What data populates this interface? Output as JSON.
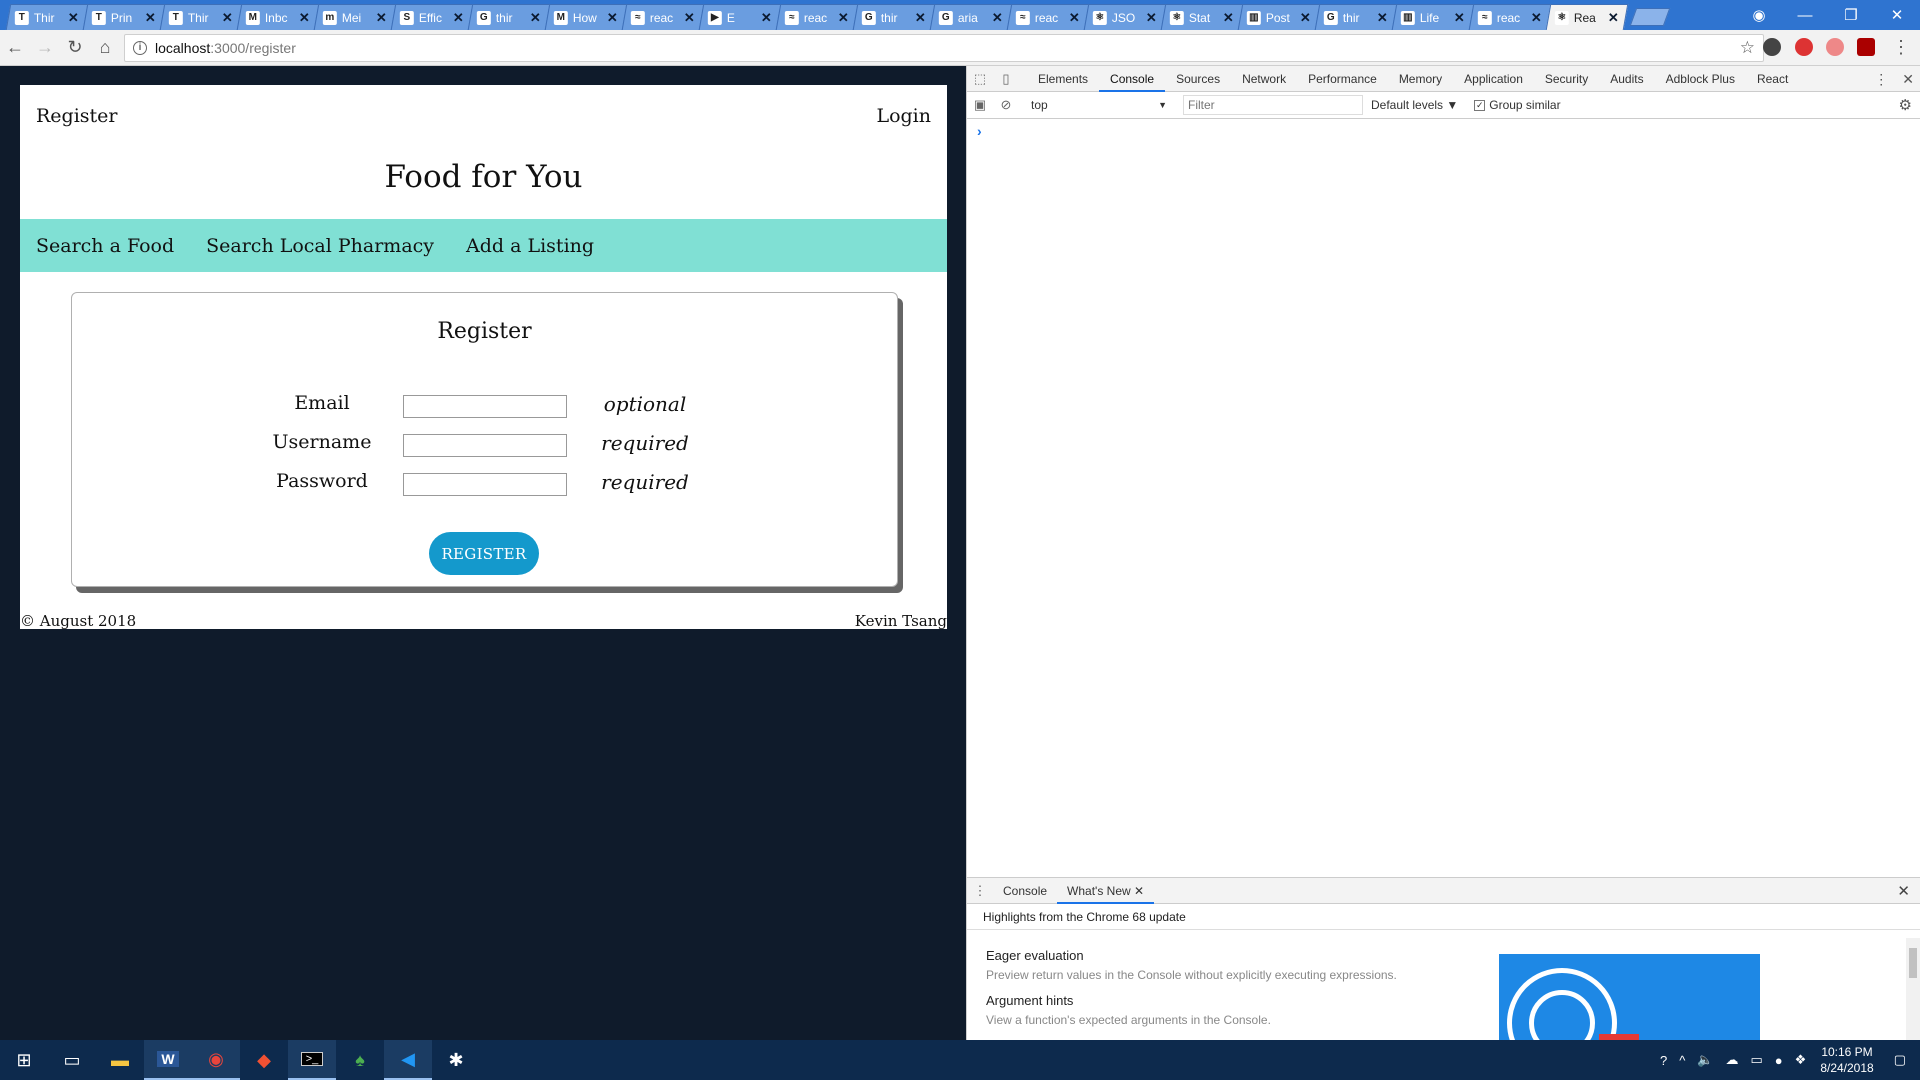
{
  "browser": {
    "tabs": [
      {
        "fav": "T",
        "title": "Thir"
      },
      {
        "fav": "T",
        "title": "Prin"
      },
      {
        "fav": "T",
        "title": "Thir"
      },
      {
        "fav": "M",
        "title": "Inbc"
      },
      {
        "fav": "m",
        "title": "Mei"
      },
      {
        "fav": "S",
        "title": "Effic"
      },
      {
        "fav": "G",
        "title": "thir"
      },
      {
        "fav": "M",
        "title": "How"
      },
      {
        "fav": "≈",
        "title": "reac"
      },
      {
        "fav": "▶",
        "title": "E"
      },
      {
        "fav": "≈",
        "title": "reac"
      },
      {
        "fav": "G",
        "title": "thir"
      },
      {
        "fav": "G",
        "title": "aria"
      },
      {
        "fav": "≈",
        "title": "reac"
      },
      {
        "fav": "⚛",
        "title": "JSO"
      },
      {
        "fav": "⚛",
        "title": "Stat"
      },
      {
        "fav": "▥",
        "title": "Post"
      },
      {
        "fav": "G",
        "title": "thir"
      },
      {
        "fav": "▥",
        "title": "Life"
      },
      {
        "fav": "≈",
        "title": "reac"
      },
      {
        "fav": "⚛",
        "title": "Rea"
      }
    ],
    "tab_close": "✕",
    "url_host": "localhost",
    "url_path": ":3000/register"
  },
  "page": {
    "nav_register": "Register",
    "nav_login": "Login",
    "site_title": "Food for You",
    "menu": [
      "Search a Food",
      "Search Local Pharmacy",
      "Add a Listing"
    ],
    "form": {
      "title": "Register",
      "fields": [
        {
          "label": "Email",
          "value": "",
          "hint": "optional"
        },
        {
          "label": "Username",
          "value": "",
          "hint": "required"
        },
        {
          "label": "Password",
          "value": "",
          "hint": "required"
        }
      ],
      "submit": "REGISTER"
    },
    "footer_left": "© August 2018",
    "footer_right": "Kevin Tsang"
  },
  "devtools": {
    "tabs": [
      "Elements",
      "Console",
      "Sources",
      "Network",
      "Performance",
      "Memory",
      "Application",
      "Security",
      "Audits",
      "Adblock Plus",
      "React"
    ],
    "active_tab": "Console",
    "context": "top",
    "filter_placeholder": "Filter",
    "levels": "Default levels ▼",
    "group_similar": "Group similar",
    "drawer": {
      "tabs": [
        "Console",
        "What's New"
      ],
      "highlights": "Highlights from the Chrome 68 update",
      "features": [
        {
          "title": "Eager evaluation",
          "desc": "Preview return values in the Console without explicitly executing expressions."
        },
        {
          "title": "Argument hints",
          "desc": "View a function's expected arguments in the Console."
        }
      ]
    }
  },
  "taskbar": {
    "time": "10:16 PM",
    "date": "8/24/2018"
  },
  "colors": {
    "menubar": "#80e0d4",
    "button": "#1499cc",
    "page_bg": "#0f1b2b"
  }
}
